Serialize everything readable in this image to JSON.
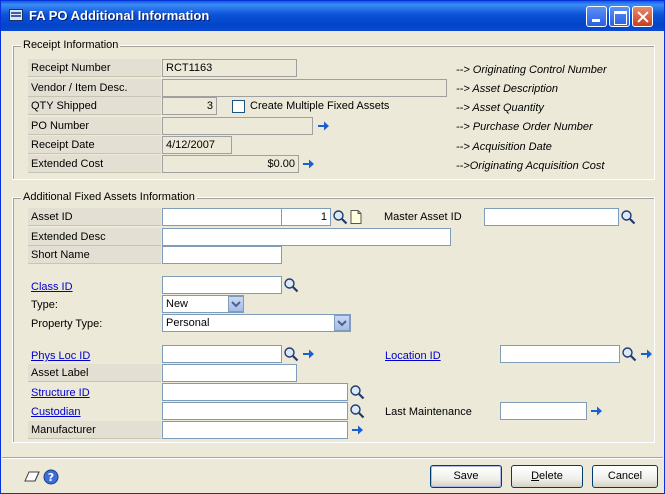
{
  "window": {
    "title": "FA PO Additional Information"
  },
  "receipt": {
    "legend": "Receipt Information",
    "rows": [
      {
        "label": "Receipt Number",
        "value": "RCT1163",
        "note": "--> Originating Control Number"
      },
      {
        "label": "Vendor / Item Desc.",
        "value": "",
        "note": "--> Asset Description"
      },
      {
        "label": "QTY Shipped",
        "value": "3",
        "note": "--> Asset Quantity"
      },
      {
        "label": "PO Number",
        "value": "",
        "note": "--> Purchase Order Number"
      },
      {
        "label": "Receipt Date",
        "value": "4/12/2007",
        "note": "--> Acquisition Date"
      },
      {
        "label": "Extended Cost",
        "value": "$0.00",
        "note": "-->Originating Acquisition Cost"
      }
    ],
    "create_multiple_label": "Create Multiple Fixed Assets",
    "create_multiple_checked": false
  },
  "additional": {
    "legend": "Additional Fixed Assets Information",
    "asset_id_label": "Asset ID",
    "asset_id_value": "",
    "asset_suffix": "1",
    "master_asset_id_label": "Master Asset ID",
    "master_asset_id_value": "",
    "extended_desc_label": "Extended Desc",
    "extended_desc_value": "",
    "short_name_label": "Short Name",
    "short_name_value": "",
    "class_id_label": "Class ID",
    "class_id_value": "",
    "type_label": "Type:",
    "type_value": "New",
    "property_type_label": "Property Type:",
    "property_type_value": "Personal",
    "phys_loc_id_label": "Phys Loc ID",
    "phys_loc_id_value": "",
    "location_id_label": "Location ID",
    "location_id_value": "",
    "asset_label_label": "Asset Label",
    "asset_label_value": "",
    "structure_id_label": "Structure ID",
    "structure_id_value": "",
    "custodian_label": "Custodian",
    "custodian_value": "",
    "last_maintenance_label": "Last Maintenance",
    "last_maintenance_value": "",
    "manufacturer_label": "Manufacturer",
    "manufacturer_value": ""
  },
  "buttons": {
    "save": "Save",
    "delete_first": "D",
    "delete_rest": "elete",
    "cancel": "Cancel"
  },
  "icons": {
    "lookup": "magnifier-icon",
    "expand": "blue-arrow-icon",
    "note": "note-icon",
    "help": "help-icon",
    "new": "new-document-icon",
    "dropdown": "chevron-down-icon"
  },
  "colors": {
    "titlebar": "#0a53d8",
    "link": "#0000cc",
    "window_bg": "#ece9d8",
    "arrow": "#1a5fd6"
  }
}
